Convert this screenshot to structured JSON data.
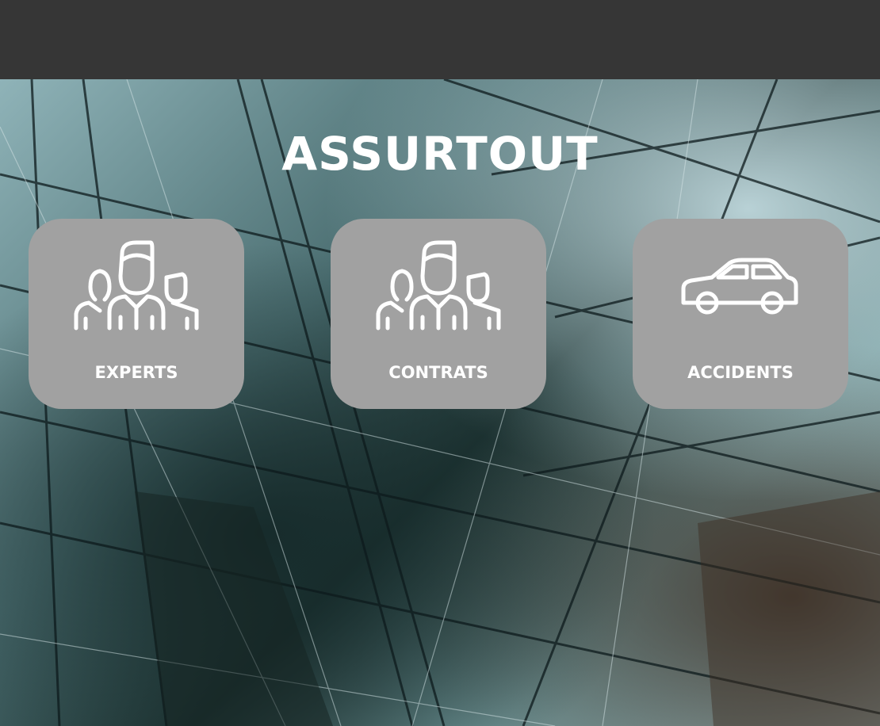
{
  "app": {
    "title": "ASSURTOUT"
  },
  "cards": [
    {
      "label": "EXPERTS",
      "icon": "people-group-icon"
    },
    {
      "label": "CONTRATS",
      "icon": "people-group-icon"
    },
    {
      "label": "ACCIDENTS",
      "icon": "car-icon"
    }
  ]
}
